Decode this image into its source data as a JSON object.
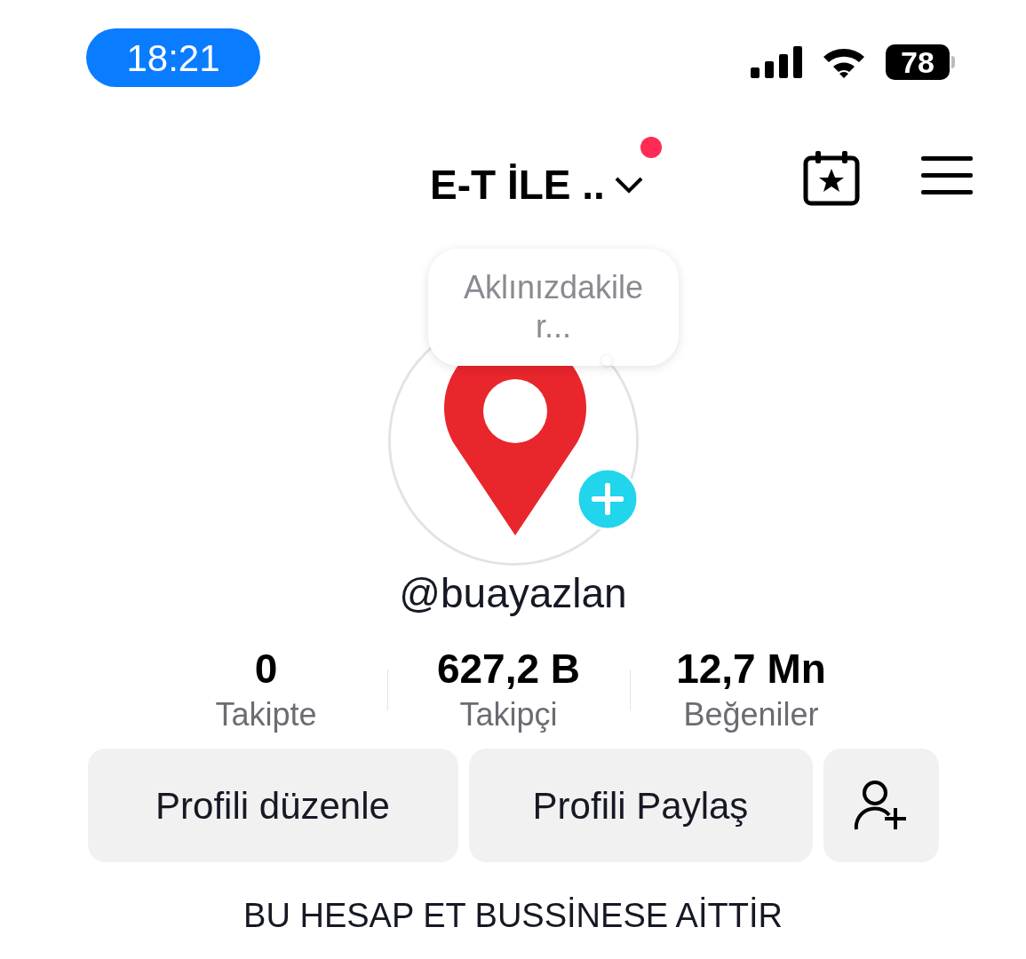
{
  "status_bar": {
    "time": "18:21",
    "battery": "78"
  },
  "header": {
    "title": "E-T İLE ..",
    "notification_dot": true
  },
  "note_bubble": {
    "placeholder": "Aklınızdakiler..."
  },
  "profile": {
    "username": "@buayazlan"
  },
  "stats": [
    {
      "value": "0",
      "label": "Takipte"
    },
    {
      "value": "627,2 B",
      "label": "Takipçi"
    },
    {
      "value": "12,7 Mn",
      "label": "Beğeniler"
    }
  ],
  "buttons": [
    {
      "kind": "text",
      "label": "Profili düzenle"
    },
    {
      "kind": "text",
      "label": "Profili Paylaş"
    },
    {
      "kind": "add_friend"
    }
  ],
  "bio": "BU HESAP ET BUSSİNESE AİTTİR"
}
